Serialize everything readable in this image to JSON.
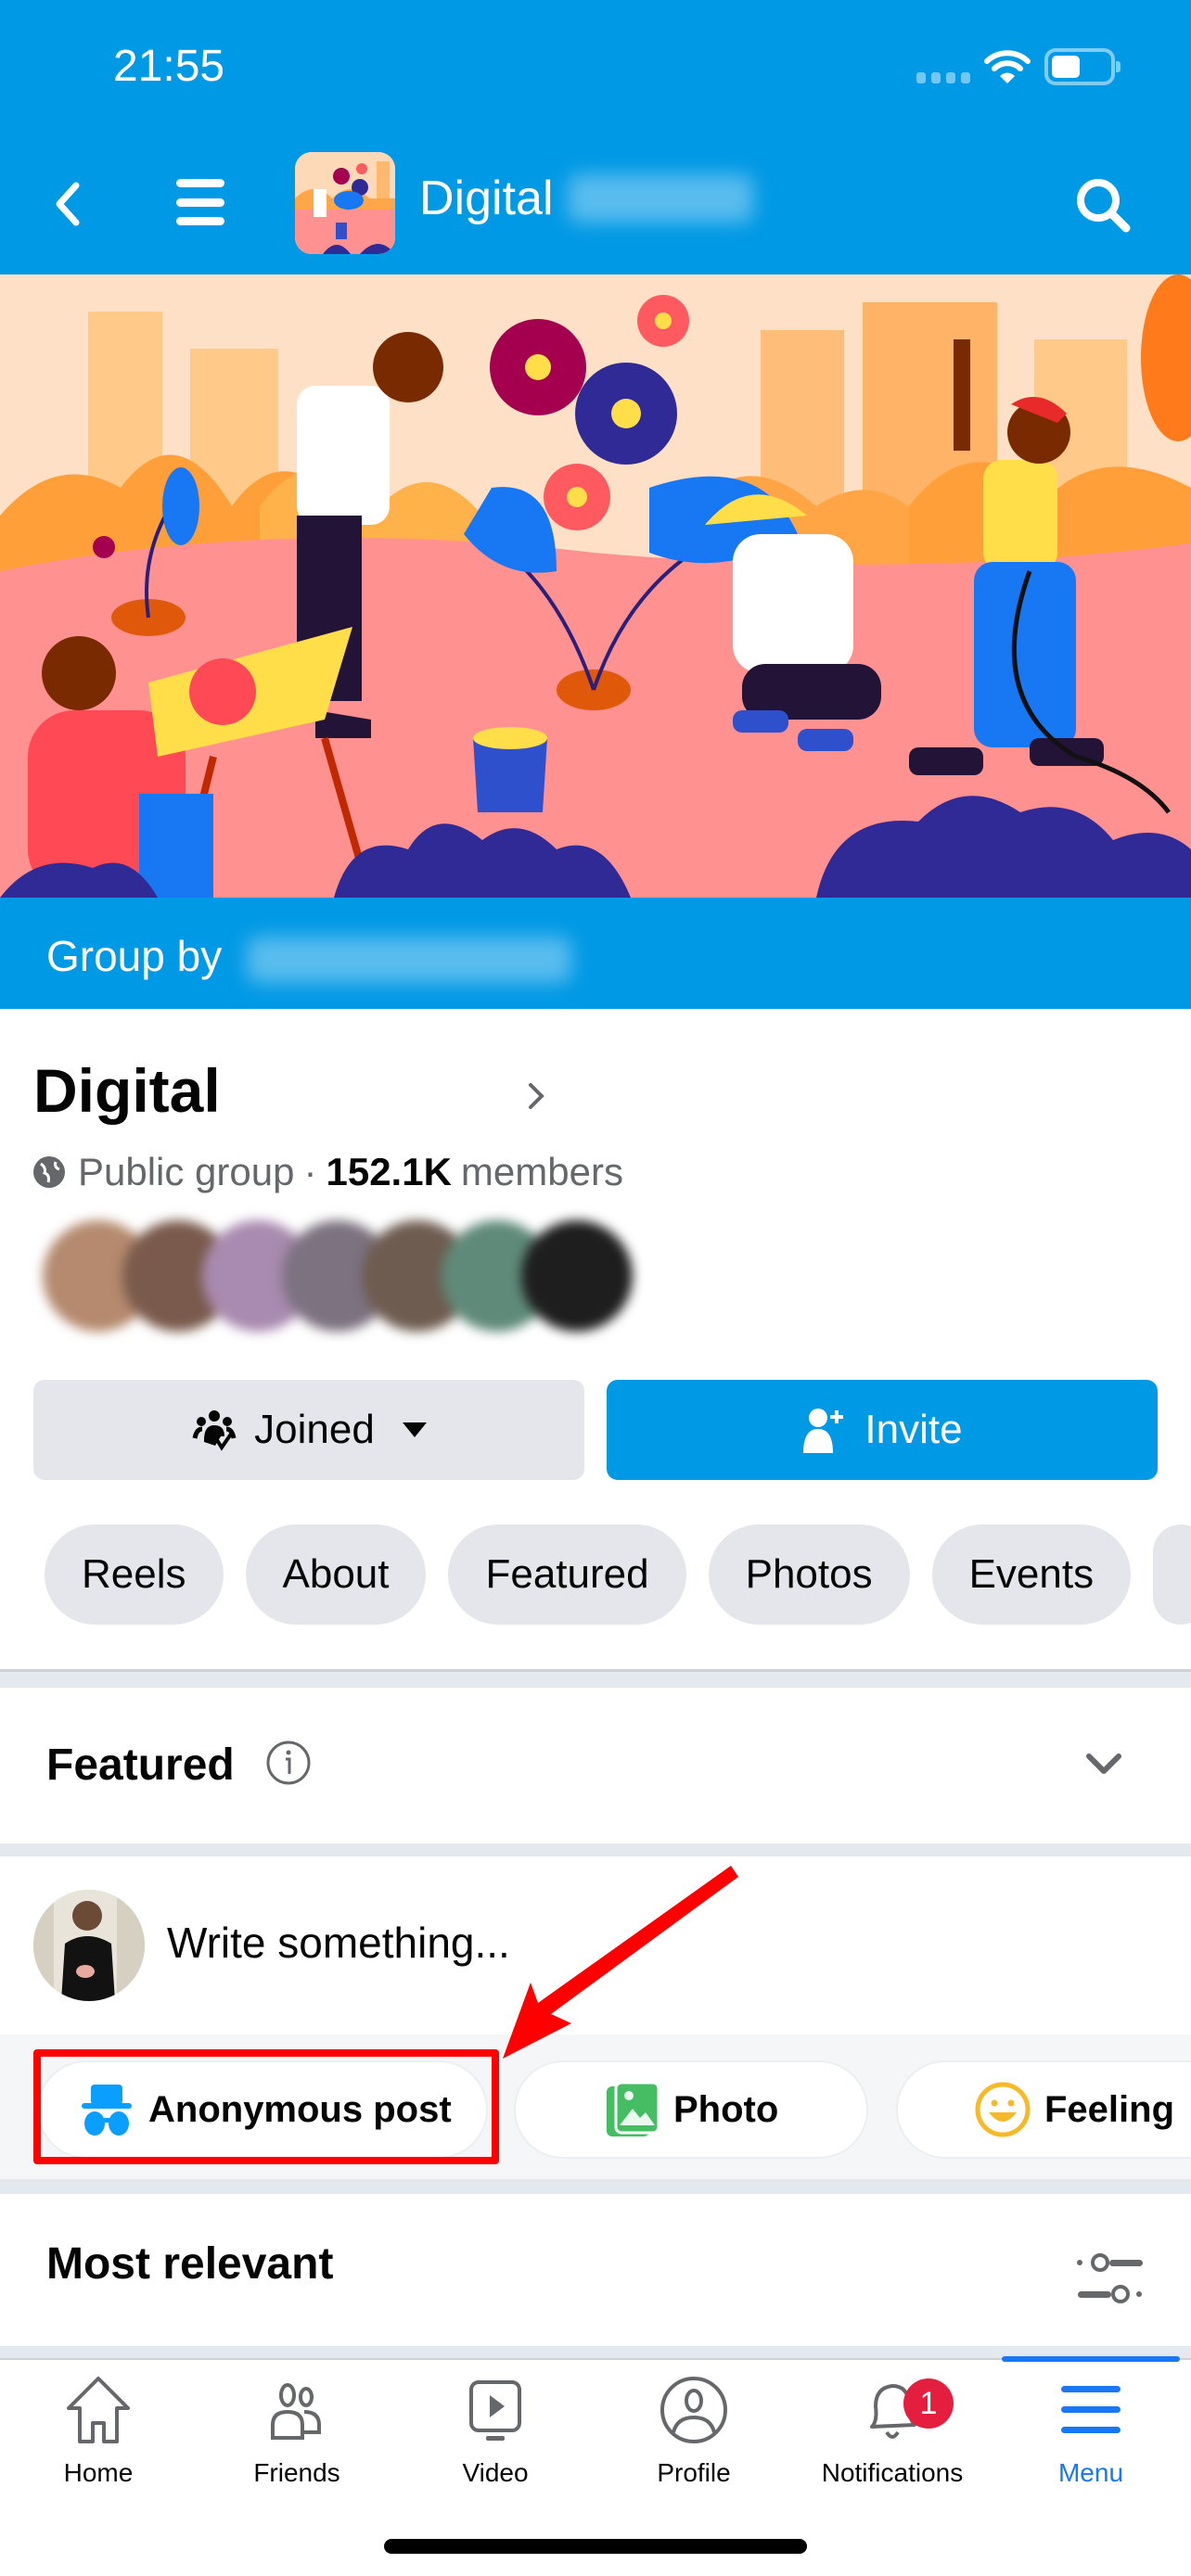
{
  "status_bar": {
    "time": "21:55",
    "wifi_icon": "wifi-icon",
    "battery_icon": "battery-icon"
  },
  "nav": {
    "back_icon": "chevron-left-icon",
    "menu_icon": "hamburger-icon",
    "title": "Digital",
    "search_icon": "search-icon"
  },
  "cover": {
    "description": "Group cover illustration: people gardening and painting in a city park"
  },
  "group_by": {
    "label": "Group by"
  },
  "group": {
    "name": "Digital",
    "privacy": "Public group",
    "separator": "·",
    "members_count": "152.1K",
    "members_label": "members"
  },
  "actions": {
    "joined_label": "Joined",
    "invite_label": "Invite"
  },
  "chips": [
    {
      "label": "Reels"
    },
    {
      "label": "About"
    },
    {
      "label": "Featured"
    },
    {
      "label": "Photos"
    },
    {
      "label": "Events"
    }
  ],
  "featured": {
    "title": "Featured"
  },
  "composer": {
    "placeholder": "Write something...",
    "options": [
      {
        "label": "Anonymous post",
        "icon": "incognito-icon"
      },
      {
        "label": "Photo",
        "icon": "photo-icon"
      },
      {
        "label": "Feeling",
        "icon": "smiley-icon"
      }
    ]
  },
  "feed": {
    "sort_label": "Most relevant"
  },
  "tabbar": {
    "items": [
      {
        "label": "Home",
        "icon": "home-icon"
      },
      {
        "label": "Friends",
        "icon": "friends-icon"
      },
      {
        "label": "Video",
        "icon": "video-icon"
      },
      {
        "label": "Profile",
        "icon": "profile-icon"
      },
      {
        "label": "Notifications",
        "icon": "bell-icon",
        "badge": "1"
      },
      {
        "label": "Menu",
        "icon": "hamburger-icon",
        "active": true
      }
    ]
  },
  "colors": {
    "brand_blue": "#0099e5",
    "active_blue": "#1877f2",
    "badge_red": "#e41e3f",
    "highlight_red": "#ff0000"
  }
}
